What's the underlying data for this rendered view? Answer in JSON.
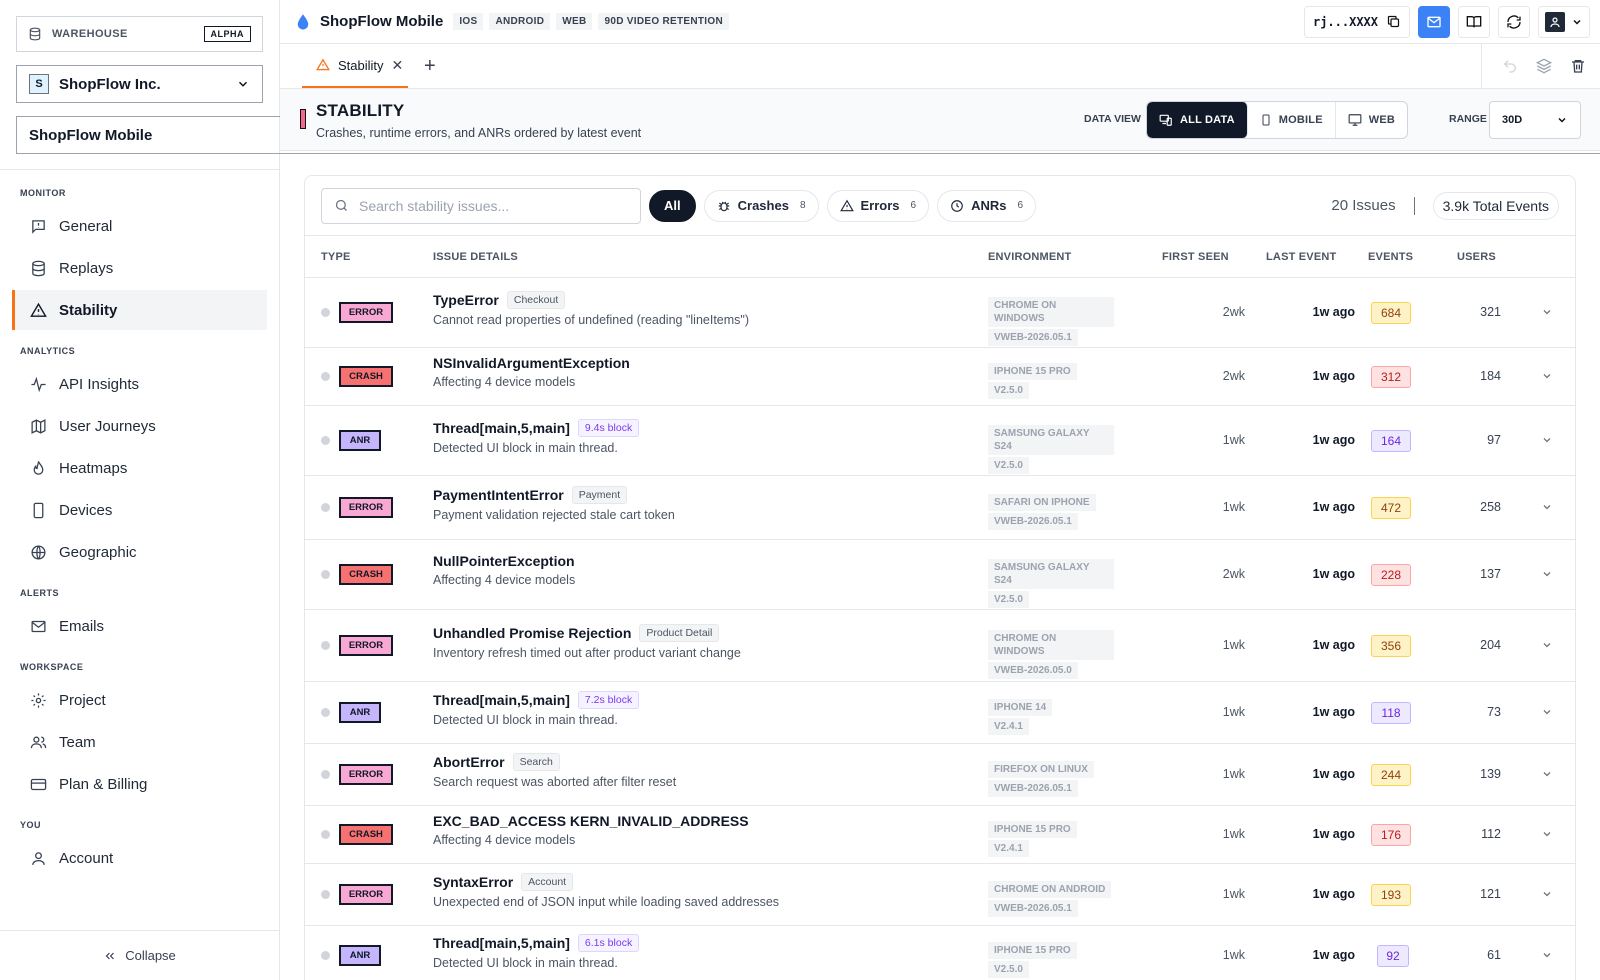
{
  "sidebar": {
    "warehouse_label": "WAREHOUSE",
    "warehouse_badge": "ALPHA",
    "org": {
      "initial": "S",
      "name": "ShopFlow Inc."
    },
    "app": "ShopFlow Mobile",
    "sections": [
      {
        "title": "MONITOR",
        "items": [
          {
            "label": "General",
            "icon": "message-icon"
          },
          {
            "label": "Replays",
            "icon": "database-icon"
          },
          {
            "label": "Stability",
            "icon": "warning-icon",
            "active": true
          }
        ]
      },
      {
        "title": "ANALYTICS",
        "items": [
          {
            "label": "API Insights",
            "icon": "activity-icon"
          },
          {
            "label": "User Journeys",
            "icon": "map-icon"
          },
          {
            "label": "Heatmaps",
            "icon": "flame-icon"
          },
          {
            "label": "Devices",
            "icon": "phone-icon"
          },
          {
            "label": "Geographic",
            "icon": "globe-icon"
          }
        ]
      },
      {
        "title": "ALERTS",
        "items": [
          {
            "label": "Emails",
            "icon": "mail-icon"
          }
        ]
      },
      {
        "title": "WORKSPACE",
        "items": [
          {
            "label": "Project",
            "icon": "gear-icon"
          },
          {
            "label": "Team",
            "icon": "users-icon"
          },
          {
            "label": "Plan & Billing",
            "icon": "card-icon"
          }
        ]
      },
      {
        "title": "YOU",
        "items": [
          {
            "label": "Account",
            "icon": "user-icon"
          }
        ]
      }
    ],
    "collapse_label": "Collapse"
  },
  "topbar": {
    "app_title": "ShopFlow Mobile",
    "tags": [
      "IOS",
      "ANDROID",
      "WEB",
      "90D VIDEO RETENTION"
    ],
    "api_key": "rj...XXXX"
  },
  "tabs": [
    {
      "label": "Stability"
    }
  ],
  "page": {
    "title": "STABILITY",
    "subtitle": "Crashes, runtime errors, and ANRs ordered by latest event",
    "data_view_label": "DATA VIEW",
    "data_view_options": [
      "ALL DATA",
      "MOBILE",
      "WEB"
    ],
    "range_label": "RANGE",
    "range_value": "30D"
  },
  "filters": {
    "search_placeholder": "Search stability issues...",
    "all_label": "All",
    "chips": [
      {
        "label": "Crashes",
        "count": "8"
      },
      {
        "label": "Errors",
        "count": "6"
      },
      {
        "label": "ANRs",
        "count": "6"
      }
    ],
    "issues_count": "20 Issues",
    "total_events": "3.9k Total Events"
  },
  "table": {
    "headers": [
      "TYPE",
      "ISSUE DETAILS",
      "ENVIRONMENT",
      "FIRST SEEN",
      "LAST EVENT",
      "EVENTS",
      "USERS"
    ],
    "rows": [
      {
        "type": "ERROR",
        "title": "TypeError",
        "tag": "Checkout",
        "desc": "Cannot read properties of undefined (reading \"lineItems\")",
        "env": "CHROME ON WINDOWS",
        "version": "VWEB-2026.05.1",
        "first": "2wk",
        "last": "1w ago",
        "events": "684",
        "users": "321"
      },
      {
        "type": "CRASH",
        "title": "NSInvalidArgumentException",
        "tag": "",
        "desc": "Affecting 4 device models",
        "env": "IPHONE 15 PRO",
        "version": "V2.5.0",
        "first": "2wk",
        "last": "1w ago",
        "events": "312",
        "users": "184"
      },
      {
        "type": "ANR",
        "title": "Thread[main,5,main]",
        "tag": "9.4s block",
        "desc": "Detected UI block in main thread.",
        "env": "SAMSUNG GALAXY S24",
        "version": "V2.5.0",
        "first": "1wk",
        "last": "1w ago",
        "events": "164",
        "users": "97"
      },
      {
        "type": "ERROR",
        "title": "PaymentIntentError",
        "tag": "Payment",
        "desc": "Payment validation rejected stale cart token",
        "env": "SAFARI ON IPHONE",
        "version": "VWEB-2026.05.1",
        "first": "1wk",
        "last": "1w ago",
        "events": "472",
        "users": "258"
      },
      {
        "type": "CRASH",
        "title": "NullPointerException",
        "tag": "",
        "desc": "Affecting 4 device models",
        "env": "SAMSUNG GALAXY S24",
        "version": "V2.5.0",
        "first": "2wk",
        "last": "1w ago",
        "events": "228",
        "users": "137"
      },
      {
        "type": "ERROR",
        "title": "Unhandled Promise Rejection",
        "tag": "Product Detail",
        "desc": "Inventory refresh timed out after product variant change",
        "env": "CHROME ON WINDOWS",
        "version": "VWEB-2026.05.0",
        "first": "1wk",
        "last": "1w ago",
        "events": "356",
        "users": "204"
      },
      {
        "type": "ANR",
        "title": "Thread[main,5,main]",
        "tag": "7.2s block",
        "desc": "Detected UI block in main thread.",
        "env": "IPHONE 14",
        "version": "V2.4.1",
        "first": "1wk",
        "last": "1w ago",
        "events": "118",
        "users": "73"
      },
      {
        "type": "ERROR",
        "title": "AbortError",
        "tag": "Search",
        "desc": "Search request was aborted after filter reset",
        "env": "FIREFOX ON LINUX",
        "version": "VWEB-2026.05.1",
        "first": "1wk",
        "last": "1w ago",
        "events": "244",
        "users": "139"
      },
      {
        "type": "CRASH",
        "title": "EXC_BAD_ACCESS KERN_INVALID_ADDRESS",
        "tag": "",
        "desc": "Affecting 4 device models",
        "env": "IPHONE 15 PRO",
        "version": "V2.4.1",
        "first": "1wk",
        "last": "1w ago",
        "events": "176",
        "users": "112"
      },
      {
        "type": "ERROR",
        "title": "SyntaxError",
        "tag": "Account",
        "desc": "Unexpected end of JSON input while loading saved addresses",
        "env": "CHROME ON ANDROID",
        "version": "VWEB-2026.05.1",
        "first": "1wk",
        "last": "1w ago",
        "events": "193",
        "users": "121"
      },
      {
        "type": "ANR",
        "title": "Thread[main,5,main]",
        "tag": "6.1s block",
        "desc": "Detected UI block in main thread.",
        "env": "IPHONE 15 PRO",
        "version": "V2.5.0",
        "first": "1wk",
        "last": "1w ago",
        "events": "92",
        "users": "61"
      }
    ]
  },
  "colors": {
    "accent": "#f97316",
    "primary": "#3b82f6",
    "error": "#f9a8d4",
    "crash": "#f87171",
    "anr": "#c4b5fd"
  }
}
